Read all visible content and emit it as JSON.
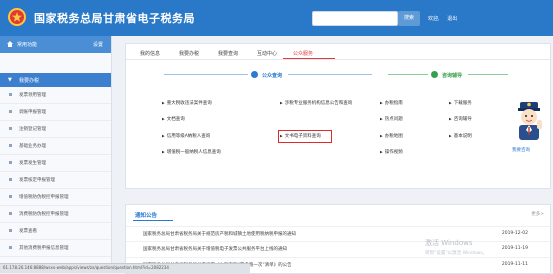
{
  "header": {
    "title": "国家税务总局甘肃省电子税务局",
    "search_button": "搜索",
    "links": [
      "欢迎,",
      "",
      "退出"
    ]
  },
  "sidebar": {
    "heading": "常用功能",
    "setting": "设置",
    "category": "我要办税",
    "items": [
      "发票领用管理",
      "调账申报管理",
      "注销登记管理",
      "基础业务办理",
      "发票发生管理",
      "发票核定申报管理",
      "增值税防伪税控申报管理",
      "消费税防伪税控申报管理",
      "发票查看",
      "其他消费税申报信息管理"
    ]
  },
  "tabs": [
    "我的信息",
    "我要办税",
    "我要查询",
    "互动中心",
    "公众服务"
  ],
  "sections": {
    "query": "公众查询",
    "help": "咨询辅导"
  },
  "services_left": [
    "重大税收违法案件查询",
    "文档查询",
    "信用等级A纳税人查询",
    "增值税一般纳税人信息查询"
  ],
  "services_mid": [
    "涉税专业服务机构信息公告和查询",
    "",
    "文书电子资料查询",
    ""
  ],
  "services_help": [
    "办税指南",
    "热点问题",
    "办税地图",
    "操作视频"
  ],
  "services_right": [
    "下载服务",
    "咨询辅导",
    "基本说明",
    ""
  ],
  "mascot_label": "我要咨询",
  "notice": {
    "title": "通知公告",
    "more": "更多>",
    "rows": [
      {
        "title": "国家税务总局甘肃省税务局关于规范房产税和城镇土地使用税纳税申报的通知",
        "date": "2019-12-02"
      },
      {
        "title": "国家税务总局甘肃省税务局关于增值税电子发票公共服务平台上线的通知",
        "date": "2019-11-19"
      },
      {
        "title": "国家税务总局甘肃省税务局关于发布《办税事项“最多跑一次”清单》的公告",
        "date": "2019-11-11"
      }
    ]
  },
  "statusbar": "61.178.26.146:8888/wsxx-web/apps/views/zx/question/question.html?id=2082234",
  "watermark": {
    "line1": "激活 Windows",
    "line2": "转到“设置”以激活 Windows。"
  },
  "colors": {
    "brand": "#2a78c8",
    "active_tab": "#e03a3a",
    "help_green": "#34a04a"
  }
}
